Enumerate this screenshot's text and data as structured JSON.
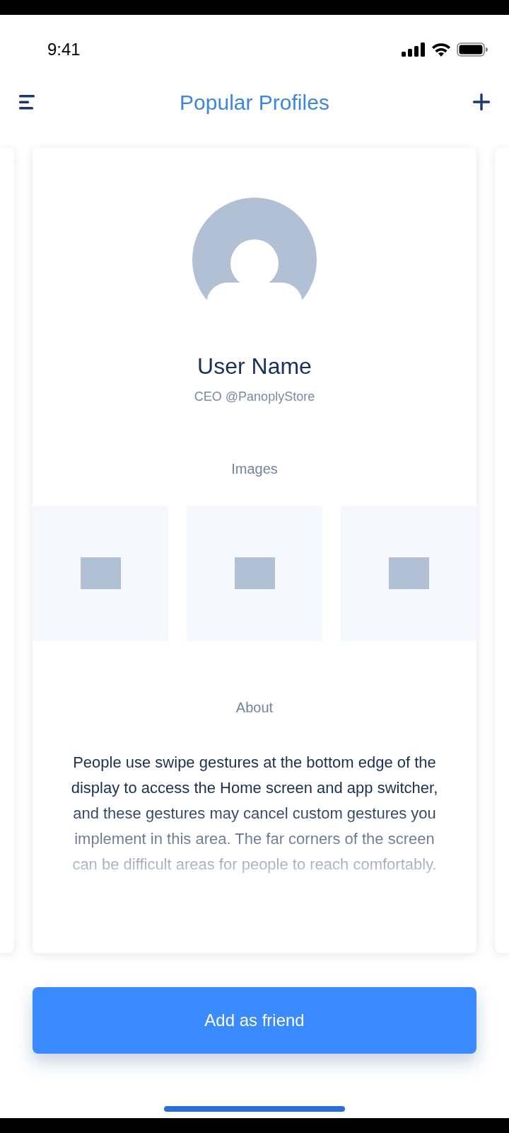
{
  "status_bar": {
    "time": "9:41"
  },
  "nav": {
    "title": "Popular Profiles"
  },
  "profile": {
    "name": "User Name",
    "role": "CEO @PanoplyStore",
    "images_label": "Images",
    "images": [
      {
        "kind": "placeholder"
      },
      {
        "kind": "placeholder"
      },
      {
        "kind": "placeholder"
      }
    ],
    "about_label": "About",
    "about_text": "People use swipe gestures at the bottom edge of the display to access the Home screen and app switcher, and these gestures may cancel custom gestures you implement in this area. The far corners of the screen can be difficult areas for people to reach comfortably."
  },
  "button": {
    "label": "Add as friend"
  }
}
